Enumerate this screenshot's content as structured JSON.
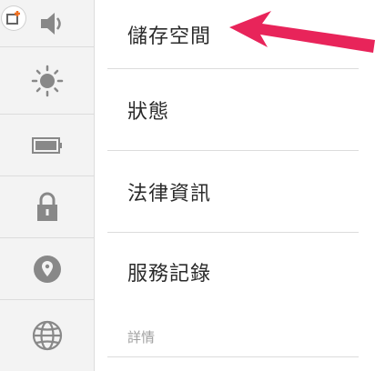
{
  "sidebar": {
    "items": [
      {
        "icon": "volume-icon"
      },
      {
        "icon": "brightness-icon"
      },
      {
        "icon": "battery-icon"
      },
      {
        "icon": "lock-icon"
      },
      {
        "icon": "location-icon"
      },
      {
        "icon": "globe-icon"
      }
    ]
  },
  "menu": {
    "items": [
      {
        "label": "儲存空間"
      },
      {
        "label": "狀態"
      },
      {
        "label": "法律資訊"
      },
      {
        "label": "服務記錄"
      }
    ],
    "section_header": "詳情"
  },
  "annotation": {
    "arrow_color": "#e8245a",
    "icon": "pointer-arrow"
  },
  "colors": {
    "sidebar_bg": "#f3f3f3",
    "divider": "#dcdcdc",
    "icon": "#888888",
    "badge_plus": "#f07020"
  }
}
